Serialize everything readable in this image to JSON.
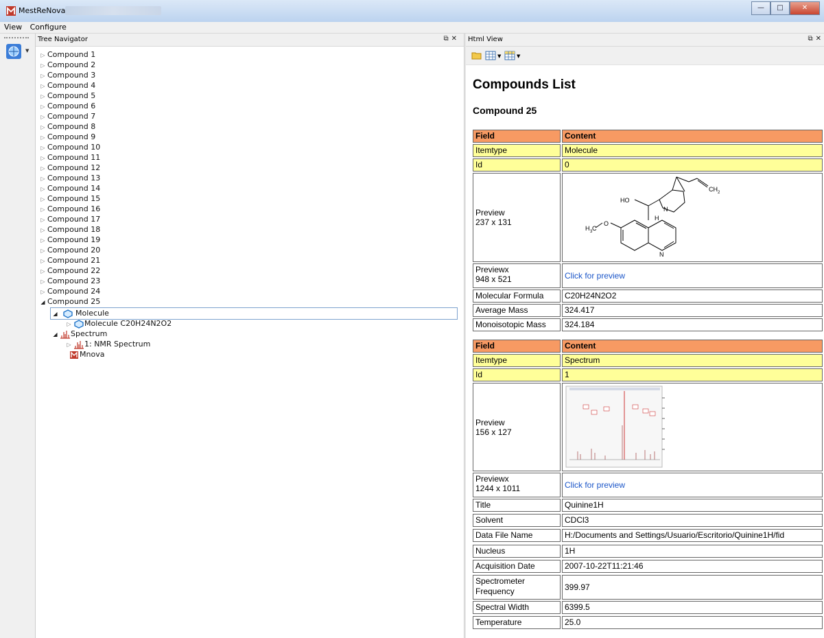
{
  "window": {
    "title": "MestReNova"
  },
  "menu": [
    "View",
    "Configure"
  ],
  "tree_panel": {
    "title": "Tree Navigator"
  },
  "tree": {
    "compounds": [
      "Compound 1",
      "Compound 2",
      "Compound 3",
      "Compound 4",
      "Compound 5",
      "Compound 6",
      "Compound 7",
      "Compound 8",
      "Compound 9",
      "Compound 10",
      "Compound 11",
      "Compound 12",
      "Compound 13",
      "Compound 14",
      "Compound 15",
      "Compound 16",
      "Compound 17",
      "Compound 18",
      "Compound 19",
      "Compound 20",
      "Compound 21",
      "Compound 22",
      "Compound 23",
      "Compound 24",
      "Compound 25"
    ],
    "molecule_label": "Molecule",
    "molecule_child": "Molecule C20H24N2O2",
    "spectrum_label": "Spectrum",
    "spectrum_child": "1: NMR Spectrum",
    "mnova_label": "Mnova"
  },
  "html_panel": {
    "title": "Html View"
  },
  "html": {
    "heading": "Compounds List",
    "subheading": "Compound 25",
    "field_header": "Field",
    "content_header": "Content",
    "molecule_rows": {
      "itemtype_label": "Itemtype",
      "itemtype_value": "Molecule",
      "id_label": "Id",
      "id_value": "0",
      "preview_label": "Preview",
      "preview_size": "237 x 131",
      "previewx_label": "Previewx",
      "previewx_size": "948 x 521",
      "previewx_link": "Click for preview",
      "formula_label": "Molecular Formula",
      "formula_value": "C20H24N2O2",
      "avgmass_label": "Average Mass",
      "avgmass_value": "324.417",
      "monomass_label": "Monoisotopic Mass",
      "monomass_value": "324.184"
    },
    "molecule_atoms": {
      "ho": "HO",
      "n1": "N",
      "h": "H",
      "ch2": "CH",
      "ch2_sub": "2",
      "h3c": "H",
      "h3c_sub": "3",
      "h3c_c": "C",
      "o": "O",
      "n2": "N"
    },
    "spectrum_rows": {
      "itemtype_label": "Itemtype",
      "itemtype_value": "Spectrum",
      "id_label": "Id",
      "id_value": "1",
      "preview_label": "Preview",
      "preview_size": "156 x 127",
      "previewx_label": "Previewx",
      "previewx_size": "1244 x 1011",
      "previewx_link": "Click for preview",
      "title_label": "Title",
      "title_value": "Quinine1H",
      "solvent_label": "Solvent",
      "solvent_value": "CDCl3",
      "datafile_label": "Data File Name",
      "datafile_value": "H:/Documents and Settings/Usuario/Escritorio/Quinine1H/fid",
      "nucleus_label": "Nucleus",
      "nucleus_value": "1H",
      "acqdate_label": "Acquisition Date",
      "acqdate_value": "2007-10-22T11:21:46",
      "specfreq_label": "Spectrometer Frequency",
      "specfreq_value": "399.97",
      "specwidth_label": "Spectral Width",
      "specwidth_value": "6399.5",
      "temp_label": "Temperature",
      "temp_value": "25.0"
    }
  },
  "colors": {
    "field_header": "#f79a63",
    "highlight_row": "#ffff99",
    "link": "#1a55c8"
  }
}
